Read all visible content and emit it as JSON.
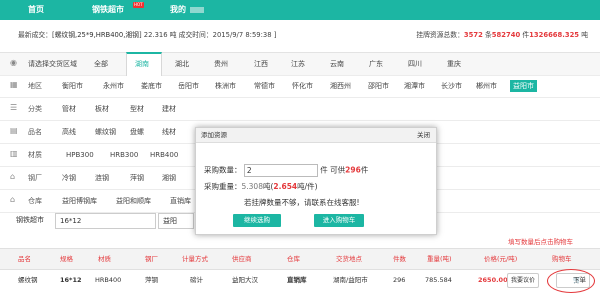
{
  "nav": {
    "home": "首页",
    "mall": "钢铁超市",
    "hot_badge": "HOT",
    "mine": "我的"
  },
  "summary": {
    "prefix": "最新成交：[",
    "deal": "螺纹钢,25*9,HRB400,湘钢",
    "tail": "] 22.316 吨  成交时间：2015/9/7 8:59:38 ]",
    "listed_label": "挂牌资源总数：",
    "listed_count": "3572",
    "sep1": " 条",
    "listed_tons": "582740",
    "sep2": " 件",
    "listed_weight": "1326668.325",
    "sep3": " 吨"
  },
  "filters": {
    "region_tabs": [
      "请选择交货区域",
      "全部",
      "湖南",
      "湖北",
      "贵州",
      "江西",
      "江苏",
      "云南",
      "广东",
      "四川",
      "重庆"
    ],
    "region_active": "湖南",
    "city_label": "地区",
    "cities": [
      "衡阳市",
      "永州市",
      "娄底市",
      "岳阳市",
      "株洲市",
      "常德市",
      "怀化市",
      "湘西州",
      "邵阳市",
      "湘潭市",
      "长沙市",
      "郴州市",
      "益阳市"
    ],
    "city_active": "益阳市",
    "category_label": "分类",
    "categories": [
      "管材",
      "板材",
      "型材",
      "建材"
    ],
    "name_label": "品名",
    "names": [
      "高线",
      "螺纹钢",
      "盘螺",
      "线材"
    ],
    "material_label": "材质",
    "materials": [
      "HPB300",
      "HRB300",
      "HRB400"
    ],
    "mill_label": "钢厂",
    "mills": [
      "冷钢",
      "涟钢",
      "萍钢",
      "湘钢"
    ],
    "warehouse_label": "仓库",
    "warehouses": [
      "益阳博钢库",
      "益阳和顺库",
      "直销库"
    ]
  },
  "search": {
    "label": "钢铁超市",
    "spec_value": "16*12",
    "city_value": "益阳"
  },
  "table": {
    "headers": [
      "品名",
      "规格",
      "材质",
      "钢厂",
      "计量方式",
      "供应商",
      "仓库",
      "交货地点",
      "件数",
      "重量(吨)",
      "价格(元/吨)",
      "购物车"
    ],
    "row": {
      "name": "螺纹钢",
      "spec": "16*12",
      "material": "HRB400",
      "mill": "萍钢",
      "measure": "磅计",
      "supplier": "益阳大汉",
      "warehouse": "直销库",
      "location": "湖南/益阳市",
      "pieces": "296",
      "weight": "785.584",
      "price": "2650.00",
      "bargain": "我要议价",
      "order": "下单"
    }
  },
  "modal": {
    "title": "添加资源",
    "close": "关闭",
    "qty_label": "采购数量：",
    "qty_value": "2",
    "qty_unit": "件  可供",
    "qty_avail": "296",
    "qty_avail_unit": "件",
    "weight_label": "采购重量：",
    "weight_value": "5.308",
    "weight_mid": "吨(",
    "weight_price": "2.654",
    "weight_tail": "吨/件)",
    "notice": "若挂牌数量不够，请联系在线客服!",
    "continue_btn": "继续选购",
    "cart_btn": "进入购物车"
  },
  "annotation": {
    "hint": "填写数量后点击购物车"
  },
  "colors": {
    "brand": "#1cb6a3",
    "accent_red": "#e4393c"
  }
}
